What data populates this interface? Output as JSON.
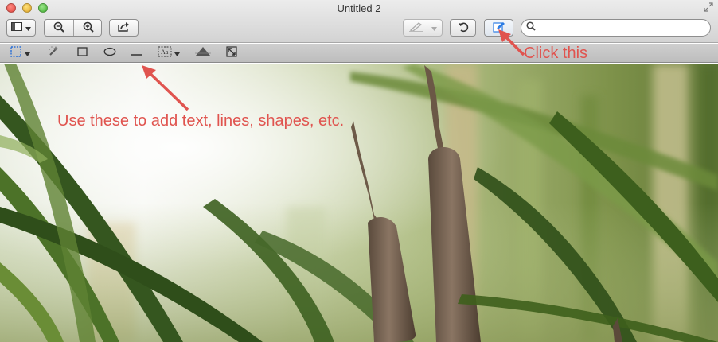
{
  "window": {
    "title": "Untitled 2"
  },
  "toolbar": {
    "view_icon": "sidebar-view-icon",
    "zoom_out_icon": "zoom-out-icon",
    "zoom_in_icon": "zoom-in-icon",
    "share_icon": "share-icon",
    "pen_icon": "pen-icon",
    "rotate_icon": "rotate-icon",
    "markup_icon": "markup-pencil-icon",
    "search": {
      "value": "",
      "placeholder": ""
    }
  },
  "markup_tools": [
    "rectangular-selection-icon",
    "instant-alpha-icon",
    "rectangle-shape-icon",
    "oval-shape-icon",
    "line-icon",
    "text-icon",
    "adjust-color-icon",
    "adjust-size-icon"
  ],
  "annotations": {
    "tools_note": "Use these to add text, lines, shapes, etc.",
    "click_note": "Click this"
  },
  "colors": {
    "annotation": "#e0544f",
    "markup_button_accent": "#2a7be4"
  }
}
